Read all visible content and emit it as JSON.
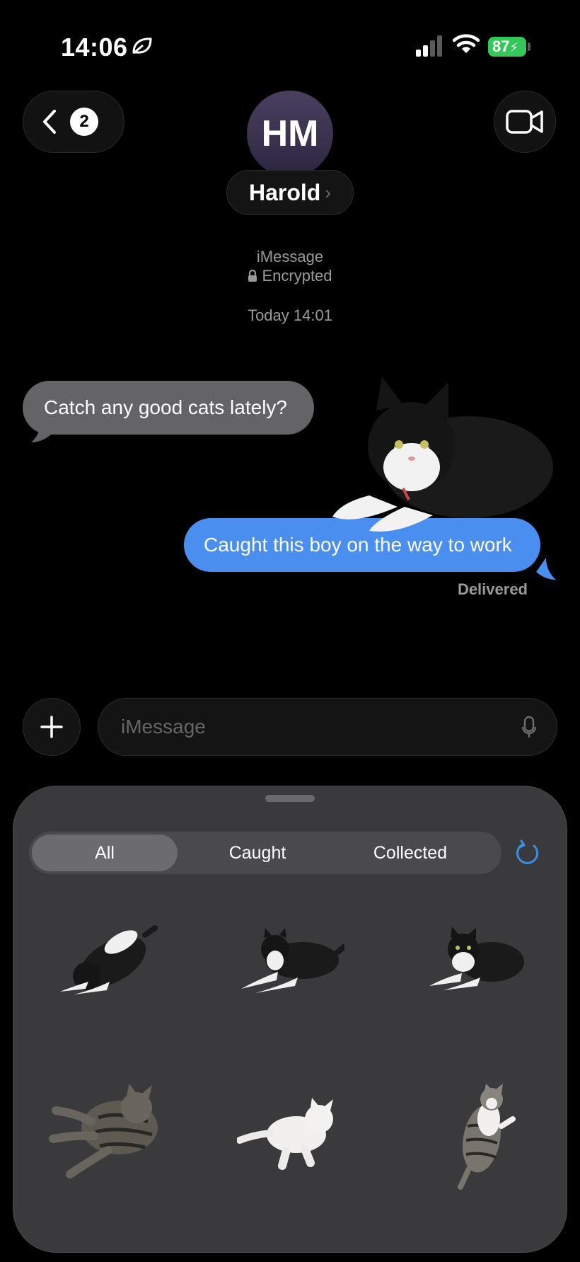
{
  "status_bar": {
    "time": "14:06",
    "battery": "87",
    "icons": [
      "leaf-icon",
      "cellular-signal-icon",
      "wifi-icon",
      "battery-charging-icon"
    ]
  },
  "header": {
    "back_count": "2",
    "avatar_initials": "HM",
    "contact_name": "Harold",
    "name_chevron": "›"
  },
  "thread": {
    "service": "iMessage",
    "encryption": "Encrypted",
    "timestamp": "Today 14:01",
    "messages": [
      {
        "direction": "incoming",
        "text": "Catch any good cats lately?"
      },
      {
        "direction": "outgoing",
        "text": "Caught this boy on the way to work"
      }
    ],
    "delivery_status": "Delivered"
  },
  "composer": {
    "placeholder": "iMessage"
  },
  "sticker_drawer": {
    "tabs": [
      "All",
      "Caught",
      "Collected"
    ],
    "selected_tab": "All",
    "stickers": [
      "tuxedo-cat-rolling-sticker",
      "tuxedo-cat-lying-sticker",
      "tuxedo-cat-resting-sticker",
      "tabby-cat-lying-sticker",
      "white-cat-lying-sticker",
      "tabby-white-cat-standing-sticker"
    ]
  },
  "colors": {
    "outgoing_bubble": "#4a8ef0",
    "incoming_bubble": "#646466",
    "battery": "#34c759",
    "accent": "#3a8fe8",
    "drawer": "#3a3a3c"
  }
}
